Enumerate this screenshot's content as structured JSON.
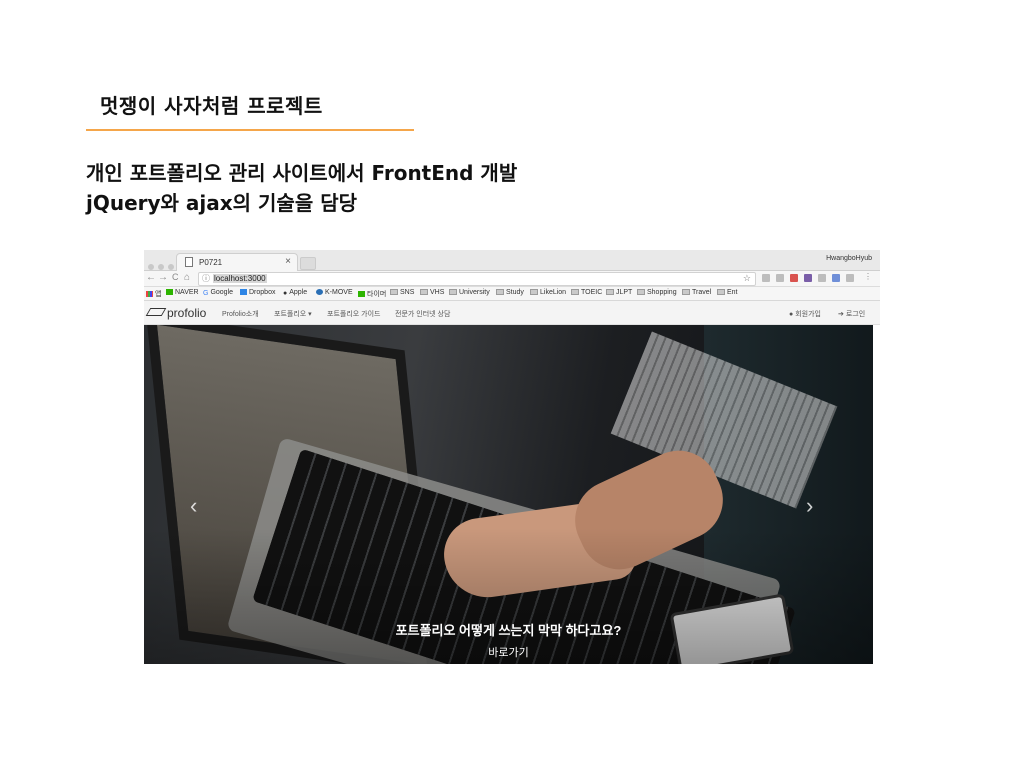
{
  "slide": {
    "title": "멋쟁이 사자처럼 프로젝트",
    "desc_line1": "개인 포트폴리오 관리 사이트에서 FrontEnd 개발",
    "desc_line2": "jQuery와 ajax의 기술을 담당"
  },
  "browser": {
    "tab_title": "P0721",
    "tab_close": "×",
    "profile_name": "HwangboHyub",
    "url": "localhost:3000",
    "info_icon": "ⓘ",
    "star_icon": "☆",
    "nav_back": "←",
    "nav_forward": "→",
    "nav_reload": "C",
    "nav_home": "⌂",
    "bookmarks": [
      {
        "label": "앱",
        "icon": "apps-icon"
      },
      {
        "label": "NAVER",
        "icon": "naver-icon",
        "color": "#2db400"
      },
      {
        "label": "Google",
        "icon": "google-icon"
      },
      {
        "label": "Dropbox",
        "icon": "dropbox-icon",
        "color": "#2f86e6"
      },
      {
        "label": "Apple",
        "icon": "apple-icon"
      },
      {
        "label": "K-MOVE",
        "icon": "kmove-icon",
        "color": "#2a6fb5"
      },
      {
        "label": "타이머",
        "icon": "timer-icon",
        "color": "#2db400"
      },
      {
        "label": "SNS",
        "icon": "folder-icon"
      },
      {
        "label": "VHS",
        "icon": "folder-icon"
      },
      {
        "label": "University",
        "icon": "folder-icon"
      },
      {
        "label": "Study",
        "icon": "folder-icon"
      },
      {
        "label": "LikeLion",
        "icon": "folder-icon"
      },
      {
        "label": "TOEIC",
        "icon": "folder-icon"
      },
      {
        "label": "JLPT",
        "icon": "folder-icon"
      },
      {
        "label": "Shopping",
        "icon": "folder-icon"
      },
      {
        "label": "Travel",
        "icon": "folder-icon"
      },
      {
        "label": "Ent",
        "icon": "folder-icon"
      }
    ]
  },
  "site": {
    "logo_text": "profolio",
    "nav": [
      "Profolio소개",
      "포트폴리오 ▾",
      "포트폴리오 가이드",
      "전문가 인터넷 상담"
    ],
    "signup": "회원가입",
    "login": "로그인",
    "signup_icon": "user-icon",
    "login_icon": "login-icon",
    "hero_caption": "포트폴리오 어떻게 쓰는지 막막 하다고요?",
    "hero_link": "바로가기",
    "prev_arrow": "‹",
    "next_arrow": "›"
  }
}
